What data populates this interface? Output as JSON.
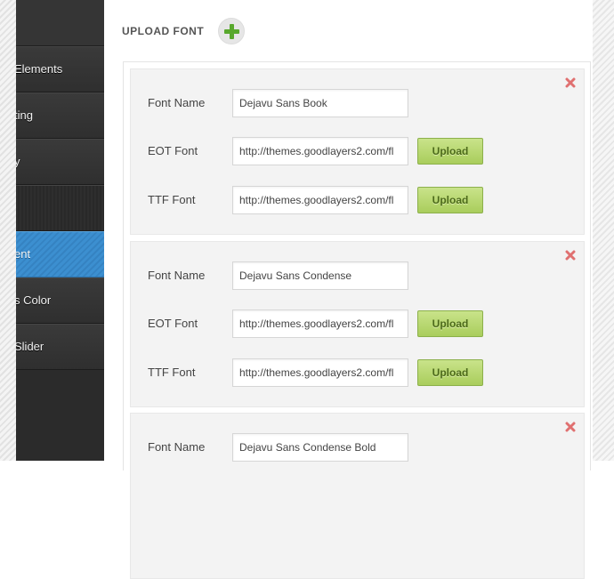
{
  "sidebar": {
    "items": [
      {
        "label": "Elements",
        "state": "normal"
      },
      {
        "label": "ting",
        "state": "normal"
      },
      {
        "label": "y",
        "state": "normal"
      },
      {
        "label": "",
        "state": "blank"
      },
      {
        "label": "ent",
        "state": "active"
      },
      {
        "label": "s Color",
        "state": "normal"
      },
      {
        "label": "Slider",
        "state": "normal"
      }
    ]
  },
  "header": {
    "title": "UPLOAD FONT",
    "add_icon": "plus-icon"
  },
  "labels": {
    "font_name": "Font Name",
    "eot_font": "EOT Font",
    "ttf_font": "TTF Font",
    "upload": "Upload"
  },
  "fonts": [
    {
      "name": "Dejavu Sans Book",
      "eot": "http://themes.goodlayers2.com/fl",
      "ttf": "http://themes.goodlayers2.com/fl"
    },
    {
      "name": "Dejavu Sans Condense",
      "eot": "http://themes.goodlayers2.com/fl",
      "ttf": "http://themes.goodlayers2.com/fl"
    },
    {
      "name": "Dejavu Sans Condense Bold",
      "eot": "",
      "ttf": ""
    }
  ],
  "colors": {
    "sidebar_bg": "#2d2d2d",
    "active_item": "#3c8fd0",
    "upload_button": "#a9cd5c",
    "add_icon": "#58a82c",
    "delete_icon": "#e07070"
  }
}
